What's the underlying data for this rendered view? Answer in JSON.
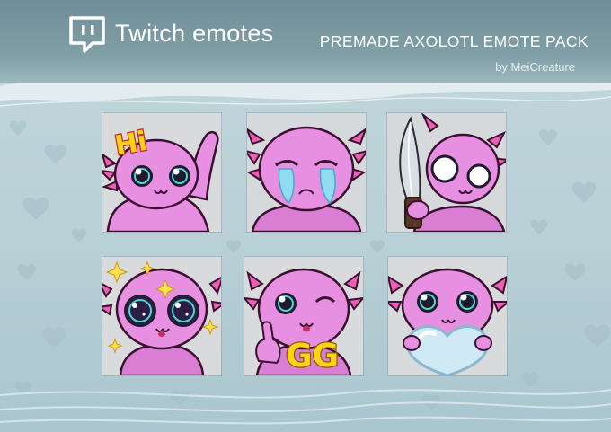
{
  "header": {
    "logo_icon": "twitch-logo-icon",
    "title": "Twitch emotes",
    "pack_title": "PREMADE AXOLOTL EMOTE PACK",
    "byline": "by MeiCreature"
  },
  "palette": {
    "header_bg": "#6f8d96",
    "background": "#c4d8dd",
    "tile_bg": "#d9dcde",
    "axolotl_pink": "#e78fe0",
    "gill_pink": "#ee5fb4"
  },
  "emotes": [
    {
      "name": "emote-hi-wave",
      "text_art": "Hi"
    },
    {
      "name": "emote-crying"
    },
    {
      "name": "emote-knife"
    },
    {
      "name": "emote-sparkle-eyes"
    },
    {
      "name": "emote-gg-wink",
      "text_art": "GG"
    },
    {
      "name": "emote-heart"
    }
  ]
}
